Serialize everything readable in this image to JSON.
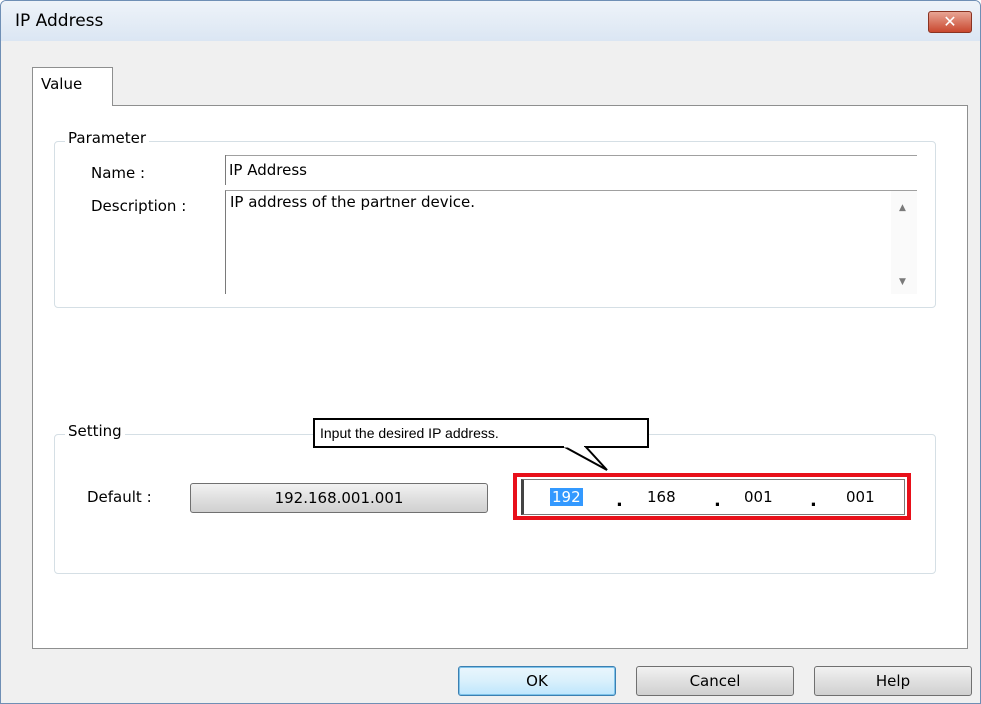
{
  "window": {
    "title": "IP Address",
    "close_symbol": "✕"
  },
  "tabs": [
    {
      "label": "Value"
    }
  ],
  "parameter": {
    "group_label": "Parameter",
    "name_label": "Name :",
    "name_value": "IP Address",
    "description_label": "Description :",
    "description_value": "IP address of the partner device."
  },
  "setting": {
    "group_label": "Setting",
    "default_label": "Default :",
    "default_button": "192.168.001.001",
    "ip_octets": [
      "192",
      "168",
      "001",
      "001"
    ],
    "ip_separator": "."
  },
  "callout": {
    "text": "Input the desired IP address."
  },
  "buttons": {
    "ok": "OK",
    "cancel": "Cancel",
    "help": "Help"
  },
  "colors": {
    "highlight": "#e8101a",
    "selection": "#3399ff",
    "title_bg": "#dbe6f3"
  }
}
